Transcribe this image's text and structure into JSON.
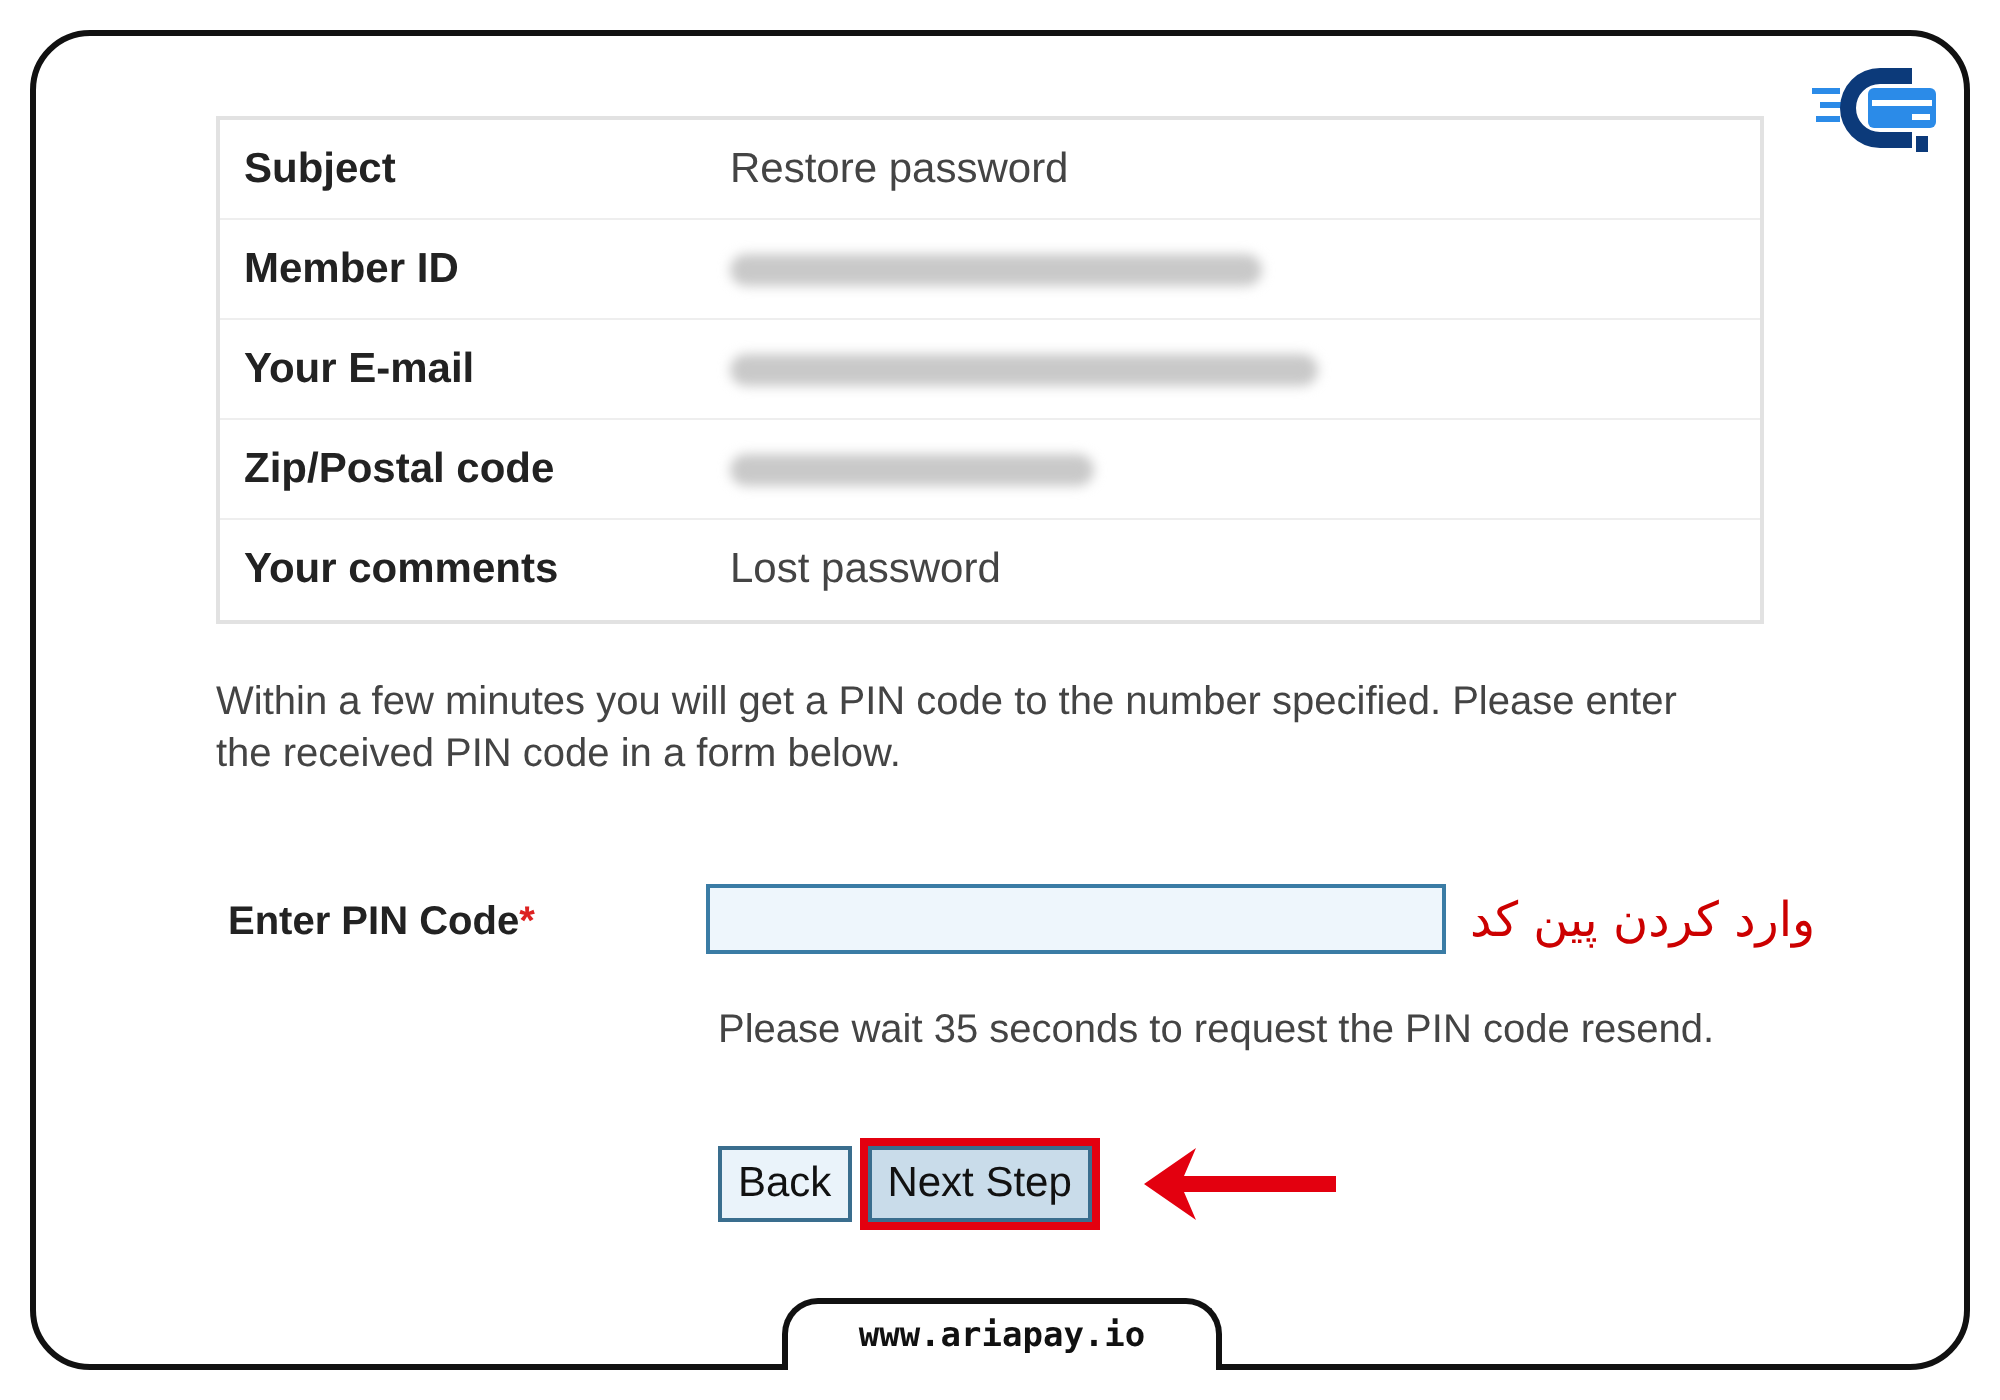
{
  "details": [
    {
      "label": "Subject",
      "kind": "text",
      "value": "Restore password"
    },
    {
      "label": "Member ID",
      "kind": "redacted"
    },
    {
      "label": "Your E-mail",
      "kind": "redacted"
    },
    {
      "label": "Zip/Postal code",
      "kind": "redacted"
    },
    {
      "label": "Your comments",
      "kind": "text",
      "value": "Lost password"
    }
  ],
  "instructions": "Within a few minutes you will get a PIN code to the number specified. Please enter the received PIN code in a form below.",
  "pin_field": {
    "label": "Enter PIN Code",
    "required_mark": "*",
    "annotation": "وارد کردن پین کد"
  },
  "wait_message": "Please wait 35 seconds to request the PIN code resend.",
  "buttons": [
    {
      "label": "Back",
      "highlighted": false
    },
    {
      "label": "Next Step",
      "highlighted": true
    }
  ],
  "footer": {
    "website": "www.ariapay.io"
  }
}
